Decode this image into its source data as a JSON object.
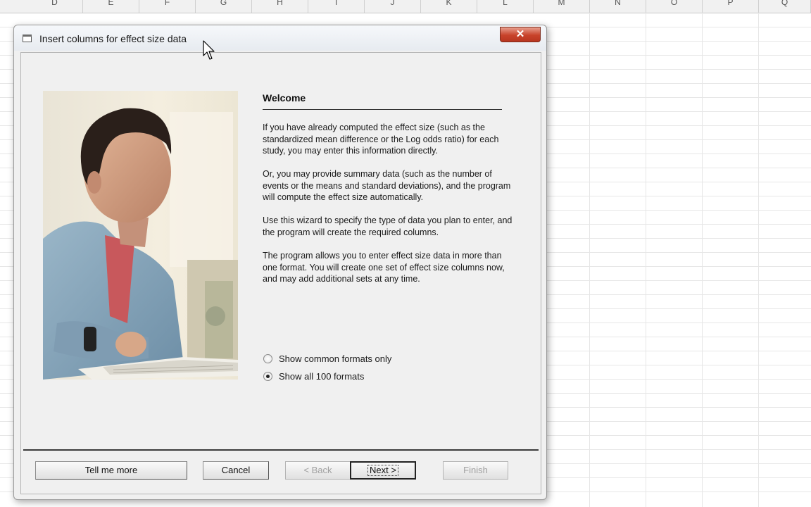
{
  "sheet": {
    "column_headers": [
      "D",
      "E",
      "F",
      "G",
      "H",
      "I",
      "J",
      "K",
      "L",
      "M",
      "N",
      "O",
      "P",
      "Q"
    ]
  },
  "dialog": {
    "title": "Insert columns for effect size data",
    "close_glyph": "✕",
    "welcome_heading": "Welcome",
    "paragraphs": [
      "If you have already computed the effect size (such as the standardized mean difference or the Log odds ratio) for each study, you may enter this information directly.",
      "Or, you may provide summary data (such as the number of events or the means and standard deviations), and the program will compute the effect size automatically.",
      "Use this wizard to specify the type of data you plan to enter, and the program will create the required columns.",
      "The program allows you to enter effect size data in more than one format.  You will create one set of effect size columns now, and may add additional sets at any time."
    ],
    "radio_options": [
      {
        "label": "Show common formats only",
        "checked": false
      },
      {
        "label": "Show all 100 formats",
        "checked": true
      }
    ],
    "buttons": {
      "tell_me_more": "Tell me more",
      "cancel": "Cancel",
      "back": "< Back",
      "next": "Next >",
      "finish": "Finish"
    }
  },
  "icons": {
    "title_icon": "window-icon",
    "close_icon": "close-icon",
    "cursor": "mouse-pointer-icon"
  },
  "colors": {
    "close_button": "#c8432b",
    "dialog_background": "#f0f0f0"
  }
}
